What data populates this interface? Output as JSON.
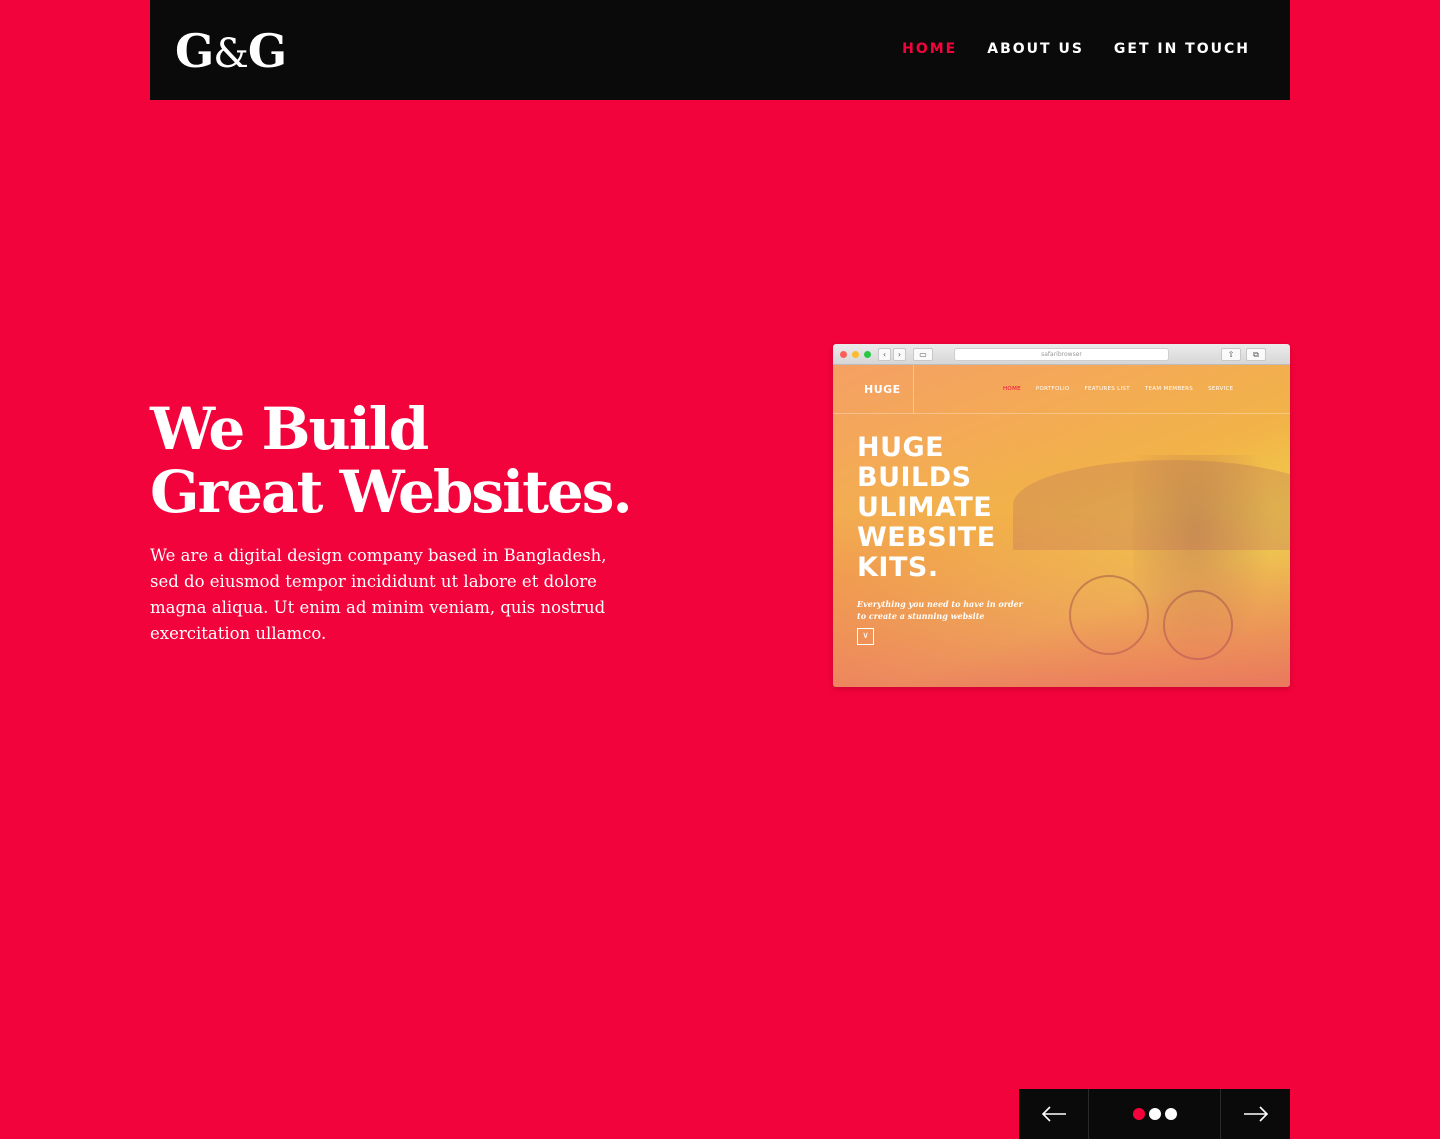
{
  "logo": {
    "left": "G",
    "amp": "&",
    "right": "G"
  },
  "nav": {
    "items": [
      {
        "label": "HOME",
        "active": true
      },
      {
        "label": "ABOUT US",
        "active": false
      },
      {
        "label": "GET IN TOUCH",
        "active": false
      }
    ]
  },
  "hero": {
    "title_line1": "We Build",
    "title_line2": "Great Websites.",
    "text": "We are a digital design company based in Bangladesh, sed do eiusmod tempor incididunt ut labore et dolore magna aliqua. Ut enim ad minim veniam, quis nostrud exercitation ullamco."
  },
  "mockup": {
    "url": "safaribrowser",
    "brand": "HUGE",
    "menu": [
      "HOME",
      "PORTFOLIO",
      "FEATURES LIST",
      "TEAM MEMBERS",
      "SERVICE"
    ],
    "headline_lines": [
      "HUGE",
      "BUILDS",
      "ULIMATE",
      "WEBSITE",
      "KITS."
    ],
    "subtext": "Everything you need to have in order to create a stunning website"
  },
  "slider": {
    "prev_icon": "arrow-left-icon",
    "next_icon": "arrow-right-icon",
    "dot_count": 3,
    "active_index": 0
  },
  "colors": {
    "background": "#f2033b",
    "bar": "#0a0a0a",
    "accent": "#f2033b",
    "text": "#ffffff"
  }
}
